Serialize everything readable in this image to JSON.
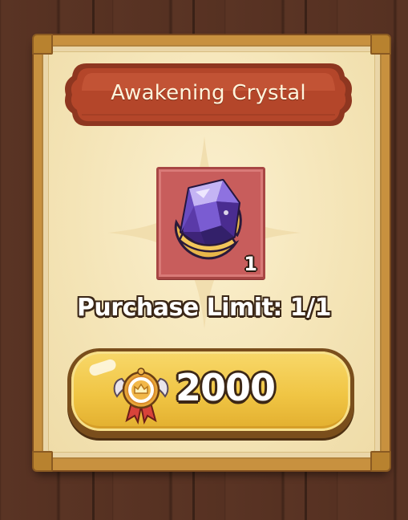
{
  "card": {
    "title": "Awakening Crystal",
    "item": {
      "icon": "awakening-crystal-icon",
      "quantity": "1",
      "tile_color": "#c85d5c"
    },
    "purchase_limit": "Purchase Limit: 1/1",
    "buy_button": {
      "currency_icon": "medal-icon",
      "price": "2000",
      "color": "#f0c544"
    }
  },
  "colors": {
    "banner": "#b4462a",
    "frame": "#c8913f",
    "parchment": "#f4e4b6",
    "background": "#563122"
  }
}
